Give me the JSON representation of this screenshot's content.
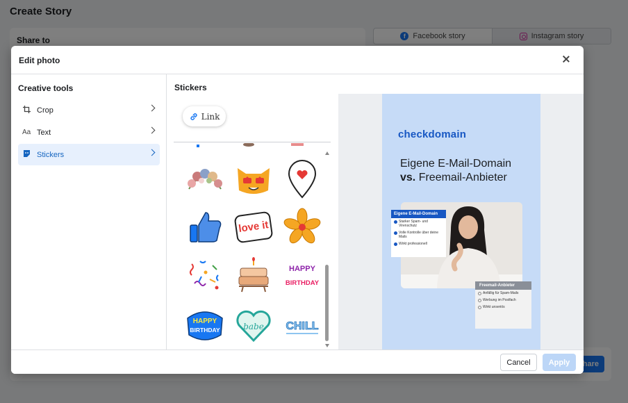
{
  "background": {
    "page_title": "Create Story",
    "share_to_label": "Share to",
    "tabs": [
      {
        "label": "Facebook story",
        "icon": "facebook-icon"
      },
      {
        "label": "Instagram story",
        "icon": "instagram-icon"
      }
    ],
    "share_button": "Share"
  },
  "modal": {
    "title": "Edit photo",
    "close_icon": "close-icon"
  },
  "creative_tools": {
    "title": "Creative tools",
    "items": [
      {
        "label": "Crop",
        "icon": "crop-icon",
        "active": false
      },
      {
        "label": "Text",
        "icon": "text-icon",
        "active": false
      },
      {
        "label": "Stickers",
        "icon": "sticker-icon",
        "active": true
      }
    ]
  },
  "stickers": {
    "title": "Stickers",
    "link_sticker": "Link",
    "items": [
      "flower-crown-sticker",
      "heart-eyes-cat-sticker",
      "heart-location-pin-sticker",
      "thumbs-up-sticker",
      "love-it-sticker",
      "orange-flower-sticker",
      "confetti-sticker",
      "birthday-cake-sticker",
      "happy-birthday-letters-sticker",
      "happy-birthday-badge-sticker",
      "babe-heart-sticker",
      "chill-sticker"
    ],
    "love_it_text": "love it",
    "happy_text": "HAPPY",
    "birthday_text": "BIRTHDAY",
    "happy_birthday_badge_1": "HAPPY",
    "happy_birthday_badge_2": "BIRTHDAY",
    "babe_text": "babe",
    "chill_text": "CHILL"
  },
  "preview": {
    "brand": "checkdomain",
    "headline_line1": "Eigene E-Mail-Domain",
    "headline_vs": "vs.",
    "headline_line2": "Freemail-Anbieter",
    "card_pro": {
      "title": "Eigene E-Mail-Domain",
      "items": [
        "Starker Spam- und Virenschutz",
        "Volle Kontrolle über deine Mails",
        "Wirkt professionell"
      ]
    },
    "card_con": {
      "title": "Freemail-Anbieter",
      "items": [
        "Anfällig für Spam-Mails",
        "Werbung im Postfach",
        "Wirkt unseriös"
      ]
    }
  },
  "footer": {
    "cancel": "Cancel",
    "apply": "Apply"
  },
  "colors": {
    "accent": "#1877f2",
    "active_bg": "#e7f0fd",
    "brand_blue": "#1757c3",
    "story_bg": "#c6dbf7"
  }
}
